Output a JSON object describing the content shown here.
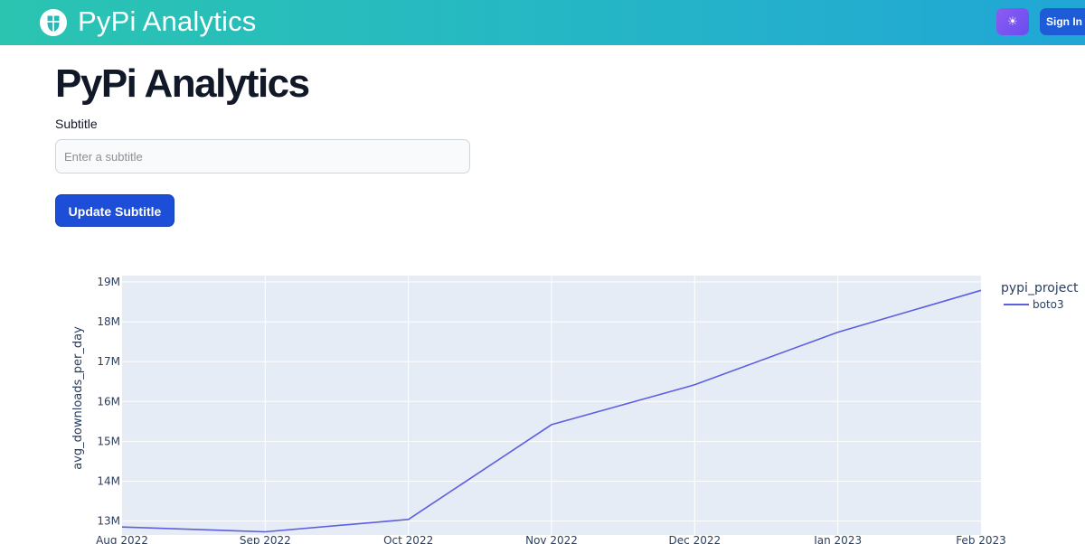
{
  "navbar": {
    "brand": "PyPi Analytics",
    "theme_toggle_icon": "sun-icon",
    "theme_toggle_glyph": "☀",
    "signin_label": "Sign In"
  },
  "main": {
    "title": "PyPi Analytics",
    "subtitle_label": "Subtitle",
    "subtitle_value": "",
    "subtitle_placeholder": "Enter a subtitle",
    "update_button_label": "Update Subtitle"
  },
  "colors": {
    "nav_gradient_start": "#2bc4b1",
    "nav_gradient_end": "#21a6d6",
    "primary_button": "#1d4ed8",
    "plot_background": "#e5ecf6",
    "series_line": "#5b5fe0"
  },
  "chart_data": {
    "type": "line",
    "ylabel": "avg_downloads_per_day",
    "xlabel": "",
    "legend_title": "pypi_project",
    "legend_placement": "right",
    "grid": true,
    "x": [
      "Aug 2022",
      "Sep 2022",
      "Oct 2022",
      "Nov 2022",
      "Dec 2022",
      "Jan 2023",
      "Feb 2023"
    ],
    "x_tick_labels": [
      "Aug 2022",
      "Sep 2022",
      "Oct 2022",
      "Nov 2022",
      "Dec 2022",
      "Jan 2023",
      "Feb 2023"
    ],
    "y_tick_values": [
      13000000,
      14000000,
      15000000,
      16000000,
      17000000,
      18000000,
      19000000
    ],
    "y_tick_labels": [
      "13M",
      "14M",
      "15M",
      "16M",
      "17M",
      "18M",
      "19M"
    ],
    "ylim": [
      12650000,
      19160000
    ],
    "series": [
      {
        "name": "boto3",
        "values": [
          12850000,
          12730000,
          13040000,
          15420000,
          16420000,
          17740000,
          18790000
        ]
      }
    ]
  }
}
